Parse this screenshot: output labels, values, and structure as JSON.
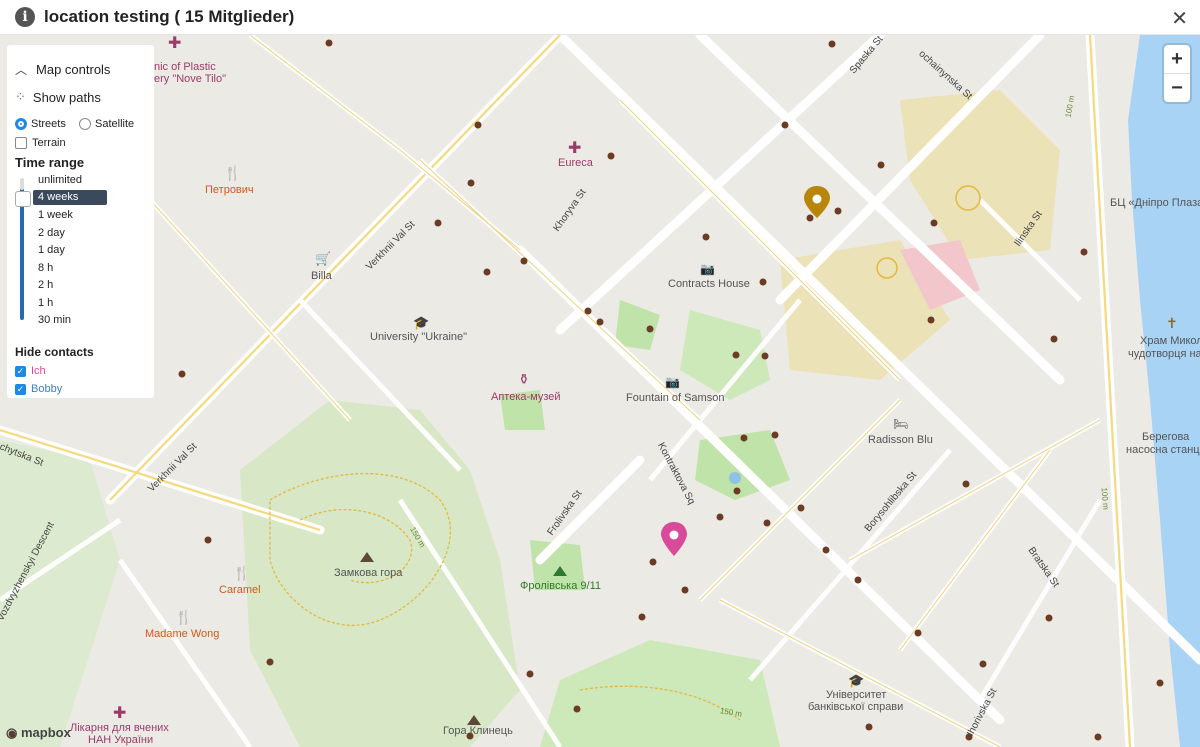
{
  "header": {
    "title": "location testing ( 15 Mitglieder)",
    "info_icon": "info-icon",
    "close_icon": "close-icon"
  },
  "controls": {
    "map_controls": "Map controls",
    "show_paths": "Show paths",
    "streets": "Streets",
    "satellite": "Satellite",
    "terrain": "Terrain",
    "map_style_selected": "Streets",
    "terrain_checked": false,
    "time_range_label": "Time range",
    "time_options": [
      "unlimited",
      "4 weeks",
      "1 week",
      "2 day",
      "1 day",
      "8 h",
      "2 h",
      "1 h",
      "30 min"
    ],
    "time_selected": "4 weeks",
    "hide_contacts_label": "Hide contacts",
    "contacts": [
      {
        "name": "Ich",
        "checked": true,
        "color": "#e0449a"
      },
      {
        "name": "Bobby",
        "checked": true,
        "color": "#3b82c4"
      }
    ]
  },
  "zoom": {
    "in": "+",
    "out": "−"
  },
  "attribution": "mapbox",
  "map_labels": {
    "clinic": "nic of Plastic",
    "clinic2": "ery \"Nove Tilo\"",
    "eureca": "Eureca",
    "petrovych": "Петрович",
    "billa": "Billa",
    "university": "University \"Ukraine\"",
    "contracts_house": "Contracts House",
    "apteka": "Аптека-музей",
    "fountain": "Fountain of Samson",
    "radisson": "Radisson Blu",
    "zamkova": "Замкова гора",
    "frolivska": "Фролівська 9/11",
    "caramel": "Caramel",
    "madame_wong": "Madame Wong",
    "hospital1": "Лікарня для вчених",
    "hospital2": "НАН України",
    "hora": "Гора Клинець",
    "univ_bank1": "Університет",
    "univ_bank2": "банківської справи",
    "bc_dnipro": "БЦ «Дніпро Плаза",
    "church1": "Храм Микол",
    "church2": "чудотворця на",
    "berehova1": "Берегова",
    "berehova2": "насосна станці"
  },
  "streets": {
    "verkhnii1": "Verkhnii Val St",
    "verkhnii2": "Verkhnii Val St",
    "khoryva": "Khoryva St",
    "spaska": "Spaska St",
    "ochainynska": "ochainynska St",
    "ilinska": "Ilinska St",
    "kontraktova": "Kontraktova Sq",
    "frolivska_st": "Frolivska St",
    "borysohlibska": "Borysohlibska St",
    "bratska": "Bratska St",
    "ihorivska": "Ihorivska St",
    "vozdvyzhenska": "Vozdvyzhenskyi Descent",
    "chytska": "chytska St",
    "contour150a": "150 m",
    "contour150b": "150 m",
    "contour100a": "100 m",
    "contour100b": "100 m"
  },
  "colors": {
    "water": "#a9d3f5",
    "park": "#cde8b9",
    "road": "#ffffff",
    "major_road": "#f5e39b",
    "pin_orange": "#b8860b",
    "pin_pink": "#d84b9a"
  }
}
